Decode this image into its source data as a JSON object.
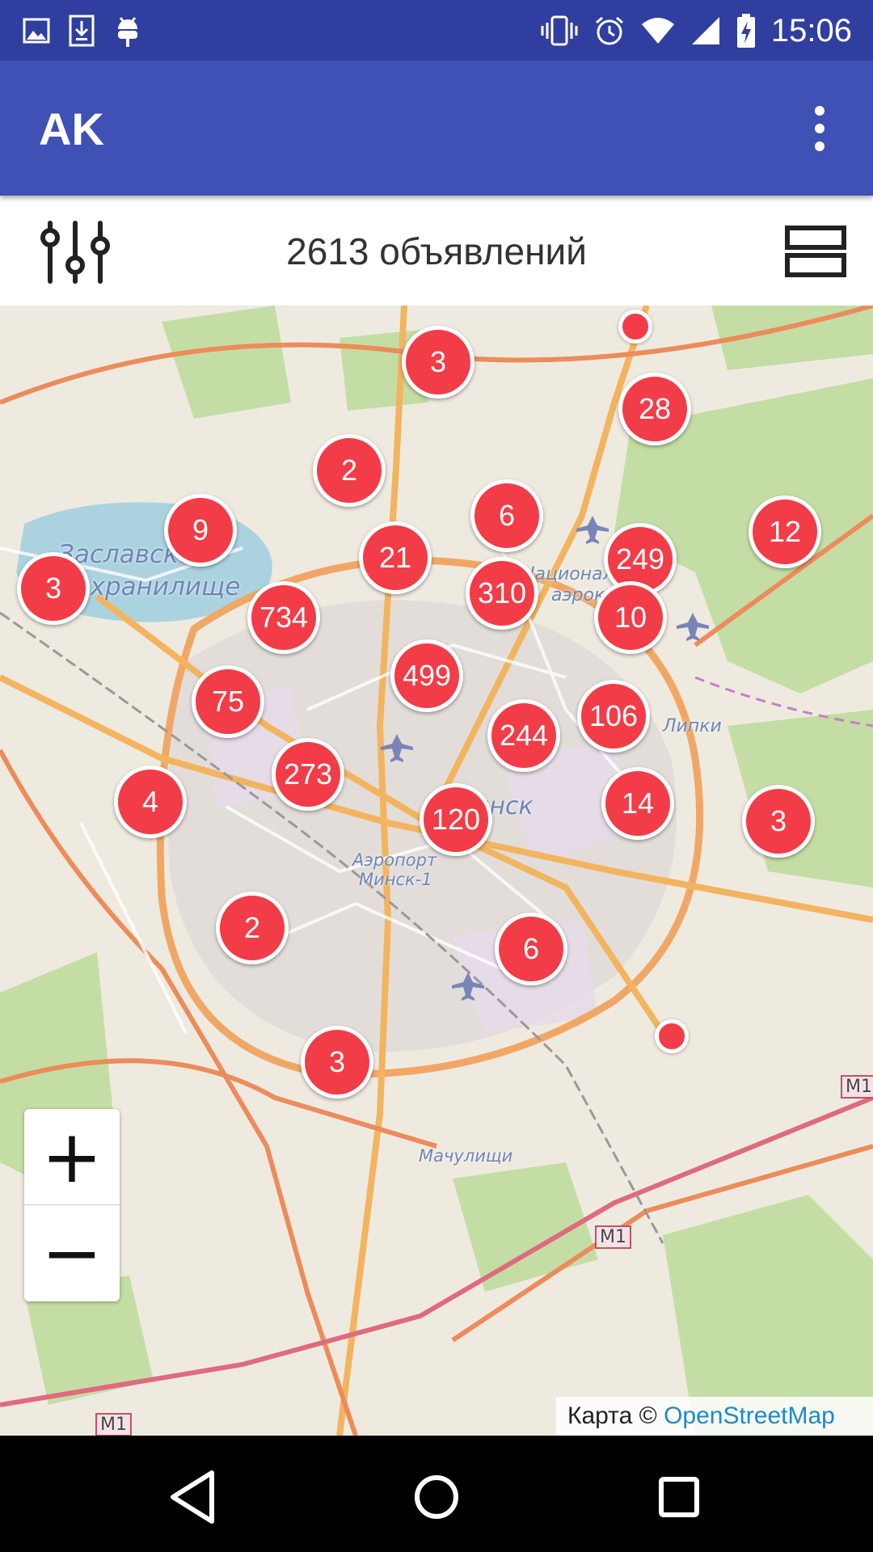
{
  "status_bar": {
    "time": "15:06",
    "left_icons": [
      "image-icon",
      "download-icon",
      "android-icon"
    ],
    "right_icons": [
      "vibrate-icon",
      "alarm-icon",
      "wifi-icon",
      "signal-icon",
      "battery-charging-icon"
    ]
  },
  "app_bar": {
    "title": "AK",
    "menu_icon": "more-vert-icon",
    "color": "#3f51b5",
    "status_color": "#303f9f"
  },
  "toolbar": {
    "count_label": "2613 объявлений",
    "filter_icon": "sliders-icon",
    "view_icon": "list-view-icon"
  },
  "map": {
    "cluster_color": "#f23c47",
    "labels": {
      "reservoir_line1": "Заславское",
      "reservoir_line2": "водохранилище",
      "aeroclub_line1": "Национальный",
      "aeroclub_line2": "аэроклуб",
      "lipki": "Липки",
      "minsk": "Минск",
      "airport_line1": "Аэропорт",
      "airport_line2": "Минск-1",
      "machulishchy": "Мачулищи",
      "road_m1": "M1"
    },
    "clusters": [
      {
        "count": "3"
      },
      {
        "count": "28"
      },
      {
        "count": "2"
      },
      {
        "count": "6"
      },
      {
        "count": "9"
      },
      {
        "count": "12"
      },
      {
        "count": "21"
      },
      {
        "count": "249"
      },
      {
        "count": "3"
      },
      {
        "count": "734"
      },
      {
        "count": "310"
      },
      {
        "count": "10"
      },
      {
        "count": "499"
      },
      {
        "count": "75"
      },
      {
        "count": "106"
      },
      {
        "count": "244"
      },
      {
        "count": "273"
      },
      {
        "count": "4"
      },
      {
        "count": "120"
      },
      {
        "count": "14"
      },
      {
        "count": "3"
      },
      {
        "count": "2"
      },
      {
        "count": "6"
      },
      {
        "count": "3"
      }
    ],
    "single_markers": 2,
    "zoom_in": "+",
    "zoom_out": "−",
    "attribution_prefix": "Карта © ",
    "attribution_link": "OpenStreetMap"
  },
  "nav_bar": {
    "back": "back-icon",
    "home": "home-icon",
    "recents": "recents-icon"
  }
}
